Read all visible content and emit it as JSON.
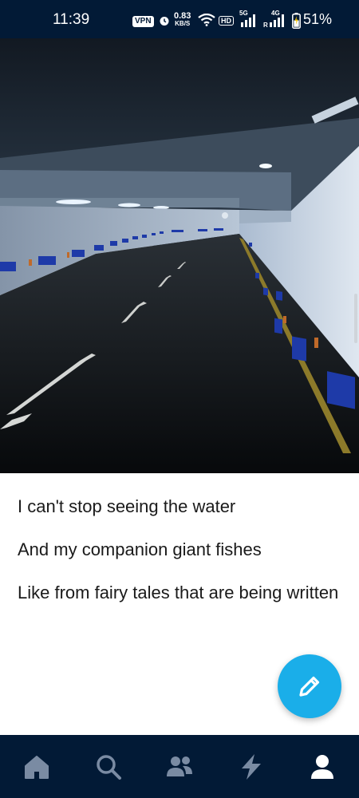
{
  "status_bar": {
    "time": "11:39",
    "vpn": "VPN",
    "speed_value": "0.83",
    "speed_unit": "KB/S",
    "hd": "HD",
    "net1": "5G",
    "net2": "4G",
    "roaming": "R",
    "battery": "51%",
    "icons": [
      "alarm-icon",
      "wifi-icon",
      "signal-icon",
      "battery-icon"
    ]
  },
  "post": {
    "image": "dark-underground-tunnel-photo",
    "lines": [
      "I can't stop seeing the water",
      "And my companion giant fishes",
      "Like from fairy tales that are being written"
    ]
  },
  "fab": {
    "icon": "pencil-icon",
    "color": "#1aaee9"
  },
  "bottom_nav": {
    "background": "#021a36",
    "items": [
      {
        "name": "home",
        "icon": "home-icon"
      },
      {
        "name": "search",
        "icon": "search-icon"
      },
      {
        "name": "communities",
        "icon": "people-icon"
      },
      {
        "name": "activity",
        "icon": "lightning-icon"
      },
      {
        "name": "account",
        "icon": "person-icon",
        "active": true
      }
    ]
  }
}
